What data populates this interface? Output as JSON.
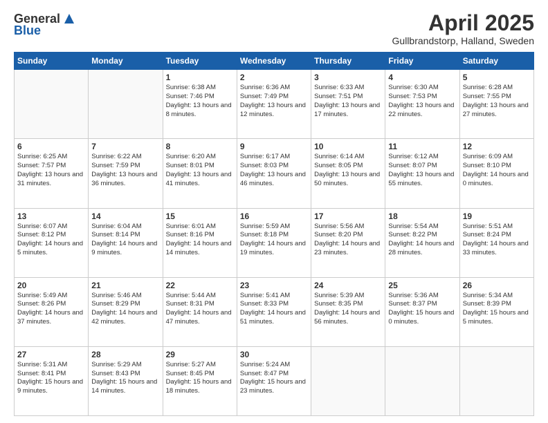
{
  "header": {
    "logo_line1": "General",
    "logo_line2": "Blue",
    "month": "April 2025",
    "location": "Gullbrandstorp, Halland, Sweden"
  },
  "days_of_week": [
    "Sunday",
    "Monday",
    "Tuesday",
    "Wednesday",
    "Thursday",
    "Friday",
    "Saturday"
  ],
  "weeks": [
    [
      {
        "day": "",
        "info": ""
      },
      {
        "day": "",
        "info": ""
      },
      {
        "day": "1",
        "info": "Sunrise: 6:38 AM\nSunset: 7:46 PM\nDaylight: 13 hours and 8 minutes."
      },
      {
        "day": "2",
        "info": "Sunrise: 6:36 AM\nSunset: 7:49 PM\nDaylight: 13 hours and 12 minutes."
      },
      {
        "day": "3",
        "info": "Sunrise: 6:33 AM\nSunset: 7:51 PM\nDaylight: 13 hours and 17 minutes."
      },
      {
        "day": "4",
        "info": "Sunrise: 6:30 AM\nSunset: 7:53 PM\nDaylight: 13 hours and 22 minutes."
      },
      {
        "day": "5",
        "info": "Sunrise: 6:28 AM\nSunset: 7:55 PM\nDaylight: 13 hours and 27 minutes."
      }
    ],
    [
      {
        "day": "6",
        "info": "Sunrise: 6:25 AM\nSunset: 7:57 PM\nDaylight: 13 hours and 31 minutes."
      },
      {
        "day": "7",
        "info": "Sunrise: 6:22 AM\nSunset: 7:59 PM\nDaylight: 13 hours and 36 minutes."
      },
      {
        "day": "8",
        "info": "Sunrise: 6:20 AM\nSunset: 8:01 PM\nDaylight: 13 hours and 41 minutes."
      },
      {
        "day": "9",
        "info": "Sunrise: 6:17 AM\nSunset: 8:03 PM\nDaylight: 13 hours and 46 minutes."
      },
      {
        "day": "10",
        "info": "Sunrise: 6:14 AM\nSunset: 8:05 PM\nDaylight: 13 hours and 50 minutes."
      },
      {
        "day": "11",
        "info": "Sunrise: 6:12 AM\nSunset: 8:07 PM\nDaylight: 13 hours and 55 minutes."
      },
      {
        "day": "12",
        "info": "Sunrise: 6:09 AM\nSunset: 8:10 PM\nDaylight: 14 hours and 0 minutes."
      }
    ],
    [
      {
        "day": "13",
        "info": "Sunrise: 6:07 AM\nSunset: 8:12 PM\nDaylight: 14 hours and 5 minutes."
      },
      {
        "day": "14",
        "info": "Sunrise: 6:04 AM\nSunset: 8:14 PM\nDaylight: 14 hours and 9 minutes."
      },
      {
        "day": "15",
        "info": "Sunrise: 6:01 AM\nSunset: 8:16 PM\nDaylight: 14 hours and 14 minutes."
      },
      {
        "day": "16",
        "info": "Sunrise: 5:59 AM\nSunset: 8:18 PM\nDaylight: 14 hours and 19 minutes."
      },
      {
        "day": "17",
        "info": "Sunrise: 5:56 AM\nSunset: 8:20 PM\nDaylight: 14 hours and 23 minutes."
      },
      {
        "day": "18",
        "info": "Sunrise: 5:54 AM\nSunset: 8:22 PM\nDaylight: 14 hours and 28 minutes."
      },
      {
        "day": "19",
        "info": "Sunrise: 5:51 AM\nSunset: 8:24 PM\nDaylight: 14 hours and 33 minutes."
      }
    ],
    [
      {
        "day": "20",
        "info": "Sunrise: 5:49 AM\nSunset: 8:26 PM\nDaylight: 14 hours and 37 minutes."
      },
      {
        "day": "21",
        "info": "Sunrise: 5:46 AM\nSunset: 8:29 PM\nDaylight: 14 hours and 42 minutes."
      },
      {
        "day": "22",
        "info": "Sunrise: 5:44 AM\nSunset: 8:31 PM\nDaylight: 14 hours and 47 minutes."
      },
      {
        "day": "23",
        "info": "Sunrise: 5:41 AM\nSunset: 8:33 PM\nDaylight: 14 hours and 51 minutes."
      },
      {
        "day": "24",
        "info": "Sunrise: 5:39 AM\nSunset: 8:35 PM\nDaylight: 14 hours and 56 minutes."
      },
      {
        "day": "25",
        "info": "Sunrise: 5:36 AM\nSunset: 8:37 PM\nDaylight: 15 hours and 0 minutes."
      },
      {
        "day": "26",
        "info": "Sunrise: 5:34 AM\nSunset: 8:39 PM\nDaylight: 15 hours and 5 minutes."
      }
    ],
    [
      {
        "day": "27",
        "info": "Sunrise: 5:31 AM\nSunset: 8:41 PM\nDaylight: 15 hours and 9 minutes."
      },
      {
        "day": "28",
        "info": "Sunrise: 5:29 AM\nSunset: 8:43 PM\nDaylight: 15 hours and 14 minutes."
      },
      {
        "day": "29",
        "info": "Sunrise: 5:27 AM\nSunset: 8:45 PM\nDaylight: 15 hours and 18 minutes."
      },
      {
        "day": "30",
        "info": "Sunrise: 5:24 AM\nSunset: 8:47 PM\nDaylight: 15 hours and 23 minutes."
      },
      {
        "day": "",
        "info": ""
      },
      {
        "day": "",
        "info": ""
      },
      {
        "day": "",
        "info": ""
      }
    ]
  ]
}
